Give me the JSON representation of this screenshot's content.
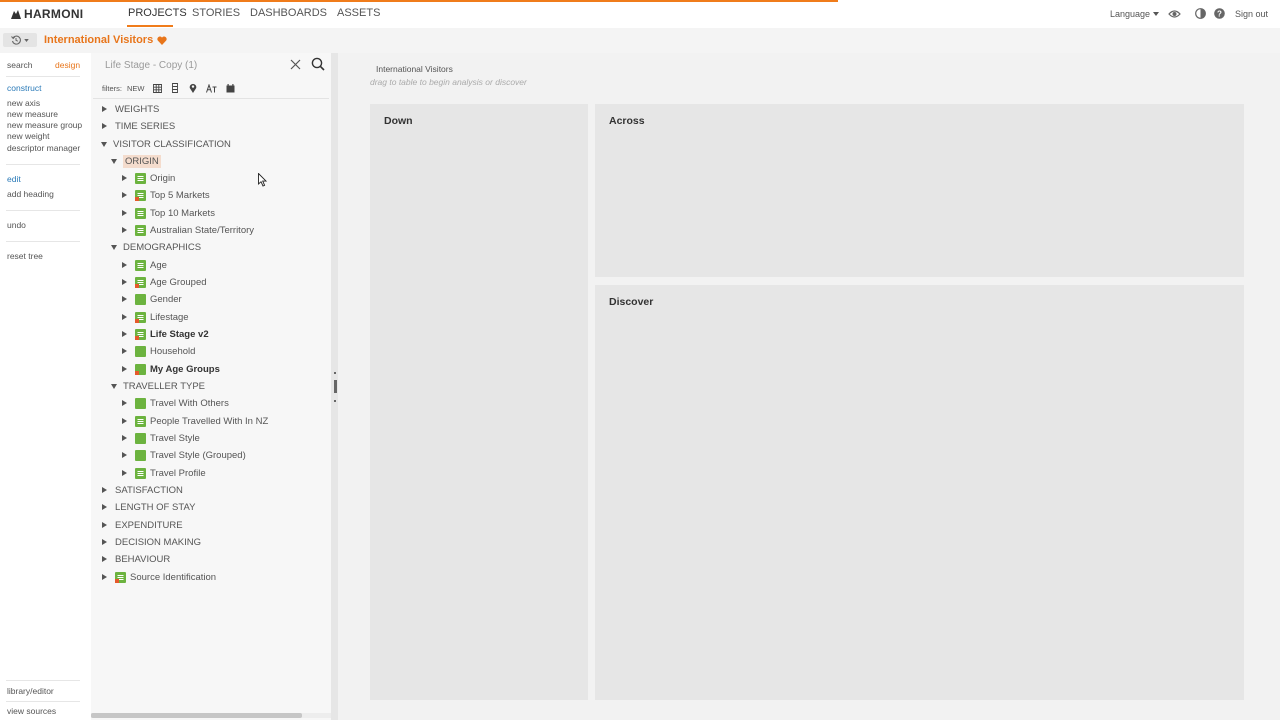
{
  "header": {
    "logo_text": "HARMONI",
    "nav": [
      "PROJECTS",
      "STORIES",
      "DASHBOARDS",
      "ASSETS"
    ],
    "language_label": "Language",
    "signout_label": "Sign out"
  },
  "project": {
    "title": "International Visitors"
  },
  "left_panel": {
    "tabs": {
      "search": "search",
      "design": "design"
    },
    "construct_heading": "construct",
    "construct_items": [
      "new axis",
      "new measure",
      "new measure group",
      "new weight",
      "descriptor manager"
    ],
    "edit_heading": "edit",
    "edit_items": [
      "add heading"
    ],
    "undo_label": "undo",
    "reset_label": "reset tree",
    "library_label": "library/editor",
    "sources_label": "view sources"
  },
  "tree_panel": {
    "search_value": "Life Stage - Copy (1)",
    "filters_label": "filters:",
    "filters_new": "NEW",
    "root_nodes": {
      "weights": "WEIGHTS",
      "time_series": "TIME SERIES",
      "visitor_classification": "VISITOR CLASSIFICATION",
      "satisfaction": "SATISFACTION",
      "length_of_stay": "LENGTH OF STAY",
      "expenditure": "EXPENDITURE",
      "decision_making": "DECISION MAKING",
      "behaviour": "BEHAVIOUR",
      "source_identification": "Source Identification"
    },
    "origin_heading": "ORIGIN",
    "origin_items": [
      "Origin",
      "Top 5 Markets",
      "Top 10 Markets",
      "Australian State/Territory"
    ],
    "demographics_heading": "DEMOGRAPHICS",
    "demographics_items": [
      "Age",
      "Age Grouped",
      "Gender",
      "Lifestage",
      "Life Stage v2",
      "Household",
      "My Age Groups"
    ],
    "traveller_heading": "TRAVELLER TYPE",
    "traveller_items": [
      "Travel With Others",
      "People Travelled With In NZ",
      "Travel Style",
      "Travel Style (Grouped)",
      "Travel Profile"
    ]
  },
  "workspace": {
    "title": "International Visitors",
    "hint": "drag to table to begin analysis or discover",
    "down_label": "Down",
    "across_label": "Across",
    "discover_label": "Discover"
  },
  "colors": {
    "accent": "#f07c1b",
    "measure_green": "#6cb33f",
    "link_blue": "#2a7ab8"
  }
}
